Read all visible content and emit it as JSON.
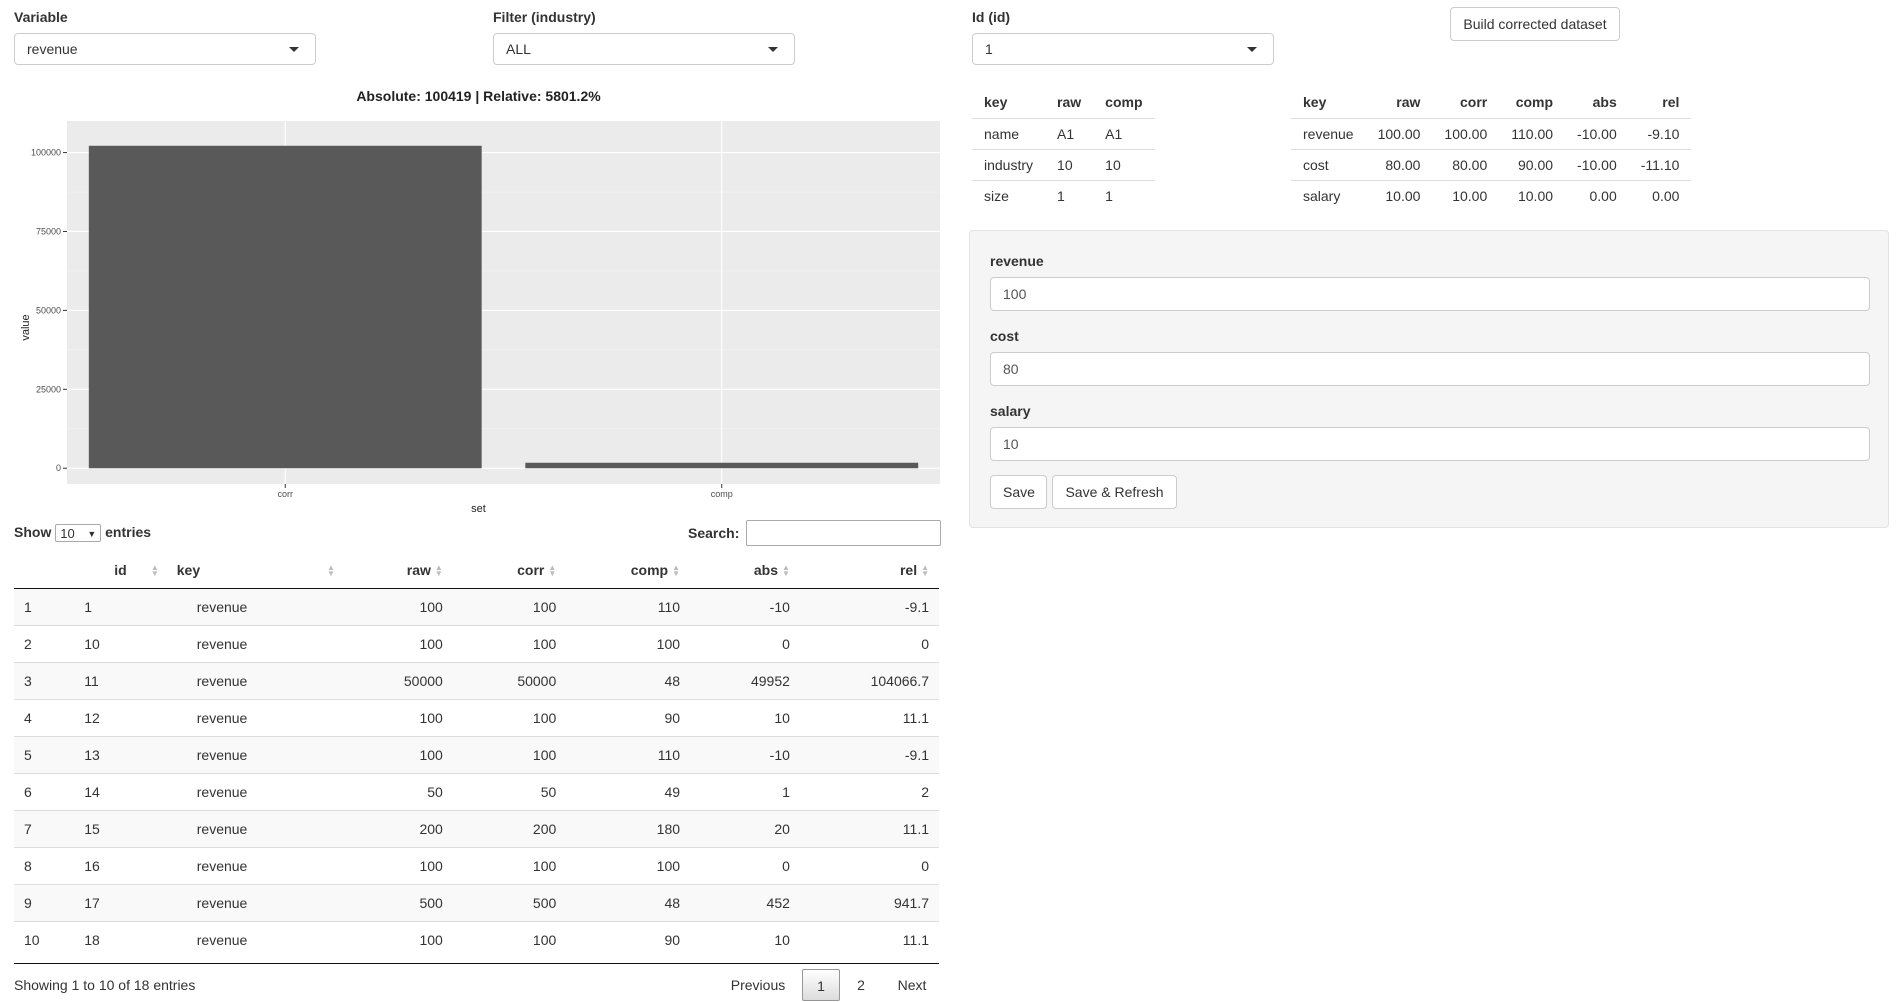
{
  "controls": {
    "variable": {
      "label": "Variable",
      "value": "revenue"
    },
    "filter": {
      "label": "Filter (industry)",
      "value": "ALL"
    },
    "id": {
      "label": "Id (id)",
      "value": "1"
    },
    "build_button": "Build corrected dataset"
  },
  "chart_data": {
    "type": "bar",
    "title": "Absolute: 100419 | Relative: 5801.2%",
    "categories": [
      "corr",
      "comp"
    ],
    "values": [
      102150,
      1731
    ],
    "xlabel": "set",
    "ylabel": "value",
    "ylim": [
      -5000,
      110000
    ],
    "yticks": [
      0,
      25000,
      50000,
      75000,
      100000
    ],
    "bar_color": "#595959",
    "panel_bg": "#ebebeb",
    "grid": true
  },
  "meta_table": {
    "headers": [
      "key",
      "raw",
      "comp"
    ],
    "rows": [
      [
        "name",
        "A1",
        "A1"
      ],
      [
        "industry",
        "10",
        "10"
      ],
      [
        "size",
        "1",
        "1"
      ]
    ]
  },
  "value_table": {
    "headers": [
      "key",
      "raw",
      "corr",
      "comp",
      "abs",
      "rel"
    ],
    "rows": [
      [
        "revenue",
        "100.00",
        "100.00",
        "110.00",
        "-10.00",
        "-9.10"
      ],
      [
        "cost",
        "80.00",
        "80.00",
        "90.00",
        "-10.00",
        "-11.10"
      ],
      [
        "salary",
        "10.00",
        "10.00",
        "10.00",
        "0.00",
        "0.00"
      ]
    ]
  },
  "edit_panel": {
    "fields": [
      {
        "label": "revenue",
        "value": "100"
      },
      {
        "label": "cost",
        "value": "80"
      },
      {
        "label": "salary",
        "value": "10"
      }
    ],
    "save_label": "Save",
    "save_refresh_label": "Save & Refresh"
  },
  "datatable": {
    "show_label": "Show",
    "entries_value": "10",
    "entries_label": "entries",
    "search_label": "Search:",
    "headers": [
      "",
      "id",
      "key",
      "raw",
      "corr",
      "comp",
      "abs",
      "rel"
    ],
    "rows": [
      [
        "1",
        "1",
        "revenue",
        "100",
        "100",
        "110",
        "-10",
        "-9.1"
      ],
      [
        "2",
        "10",
        "revenue",
        "100",
        "100",
        "100",
        "0",
        "0"
      ],
      [
        "3",
        "11",
        "revenue",
        "50000",
        "50000",
        "48",
        "49952",
        "104066.7"
      ],
      [
        "4",
        "12",
        "revenue",
        "100",
        "100",
        "90",
        "10",
        "11.1"
      ],
      [
        "5",
        "13",
        "revenue",
        "100",
        "100",
        "110",
        "-10",
        "-9.1"
      ],
      [
        "6",
        "14",
        "revenue",
        "50",
        "50",
        "49",
        "1",
        "2"
      ],
      [
        "7",
        "15",
        "revenue",
        "200",
        "200",
        "180",
        "20",
        "11.1"
      ],
      [
        "8",
        "16",
        "revenue",
        "100",
        "100",
        "100",
        "0",
        "0"
      ],
      [
        "9",
        "17",
        "revenue",
        "500",
        "500",
        "48",
        "452",
        "941.7"
      ],
      [
        "10",
        "18",
        "revenue",
        "100",
        "100",
        "90",
        "10",
        "11.1"
      ]
    ],
    "info": "Showing 1 to 10 of 18 entries",
    "pager": {
      "previous": "Previous",
      "pages": [
        "1",
        "2"
      ],
      "next": "Next"
    }
  }
}
